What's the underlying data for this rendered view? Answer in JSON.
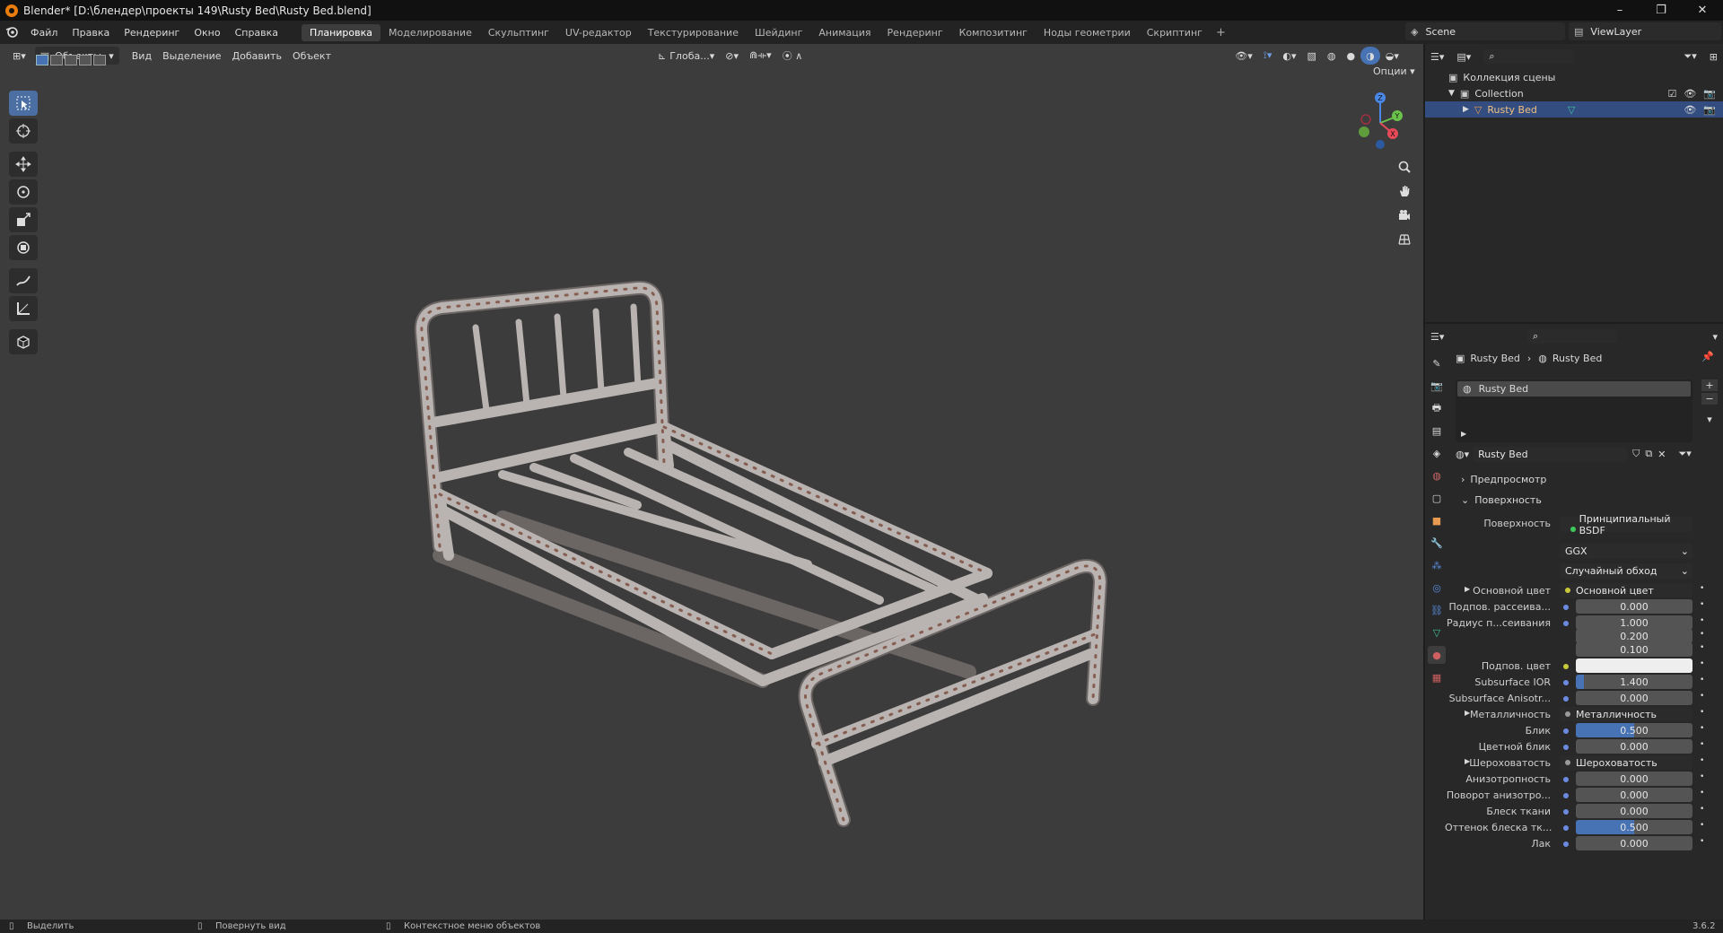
{
  "window": {
    "title": "Blender* [D:\\блендер\\проекты 149\\Rusty Bed\\Rusty Bed.blend]",
    "controls": [
      "–",
      "❐",
      "✕"
    ]
  },
  "menu": {
    "items": [
      "Файл",
      "Правка",
      "Рендеринг",
      "Окно",
      "Справка"
    ],
    "workspaces": [
      "Планировка",
      "Моделирование",
      "Скульптинг",
      "UV-редактор",
      "Текстурирование",
      "Шейдинг",
      "Анимация",
      "Рендеринг",
      "Композитинг",
      "Ноды геометрии",
      "Скриптинг"
    ],
    "active_workspace": "Планировка",
    "scene": "Scene",
    "view_layer": "ViewLayer"
  },
  "viewport": {
    "mode": "Объекты",
    "menus": [
      "Вид",
      "Выделение",
      "Добавить",
      "Объект"
    ],
    "orientation": "Глоба...",
    "options_label": "Опции",
    "gizmo_labels": {
      "z": "Z",
      "y": "Y",
      "x": "X"
    }
  },
  "outliner": {
    "scene_collection": "Коллекция сцены",
    "collection": "Collection",
    "object": "Rusty Bed"
  },
  "properties": {
    "breadcrumb_object": "Rusty Bed",
    "breadcrumb_material": "Rusty Bed",
    "slot_name": "Rusty Bed",
    "material_name": "Rusty Bed",
    "panel_preview": "Предпросмотр",
    "panel_surface": "Поверхность",
    "surface_label": "Поверхность",
    "surface_value": "Принципиальный BSDF",
    "distribution": "GGX",
    "subsurface_method": "Случайный обход",
    "rows": [
      {
        "label": "Основной цвет",
        "value": "Основной цвет",
        "kind": "link",
        "expand": true
      },
      {
        "label": "Подпов. рассеива...",
        "value": "0.000",
        "kind": "num"
      },
      {
        "label": "Радиус п...сеивания",
        "value": "1.000",
        "kind": "num"
      },
      {
        "label": "",
        "value": "0.200",
        "kind": "num"
      },
      {
        "label": "",
        "value": "0.100",
        "kind": "num"
      },
      {
        "label": "Подпов. цвет",
        "value": "",
        "kind": "color"
      },
      {
        "label": "Subsurface IOR",
        "value": "1.400",
        "kind": "num",
        "fill": 0.07
      },
      {
        "label": "Subsurface Anisotr...",
        "value": "0.000",
        "kind": "num"
      },
      {
        "label": "Металличность",
        "value": "Металличность",
        "kind": "link",
        "expand": true
      },
      {
        "label": "Блик",
        "value": "0.500",
        "kind": "num",
        "fill": 0.5
      },
      {
        "label": "Цветной блик",
        "value": "0.000",
        "kind": "num"
      },
      {
        "label": "Шероховатость",
        "value": "Шероховатость",
        "kind": "link",
        "expand": true
      },
      {
        "label": "Анизотропность",
        "value": "0.000",
        "kind": "num"
      },
      {
        "label": "Поворот анизотро...",
        "value": "0.000",
        "kind": "num"
      },
      {
        "label": "Блеск ткани",
        "value": "0.000",
        "kind": "num"
      },
      {
        "label": "Оттенок блеска тк...",
        "value": "0.500",
        "kind": "num",
        "fill": 0.5
      },
      {
        "label": "Лак",
        "value": "0.000",
        "kind": "num"
      }
    ]
  },
  "status": {
    "select": "Выделить",
    "rotate": "Повернуть вид",
    "context": "Контекстное меню объектов",
    "version": "3.6.2"
  },
  "colors": {
    "accent": "#4772b3",
    "orange": "#e87d0d",
    "viewport_bg": "#3c3c3c",
    "selected_row": "#334d80"
  }
}
